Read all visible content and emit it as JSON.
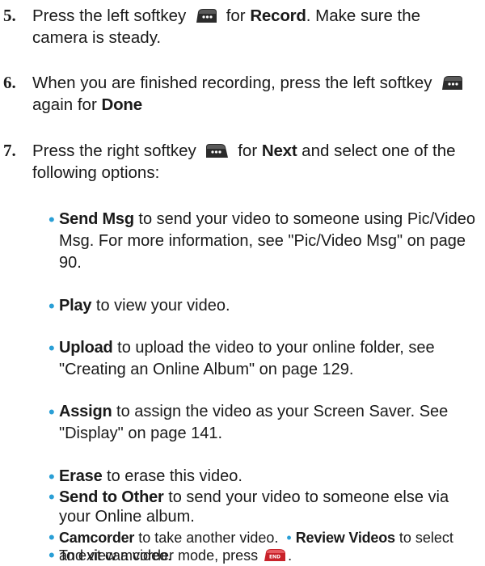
{
  "steps": [
    {
      "num": "5.",
      "part1": "Press the left softkey",
      "icon": "left-softkey-icon",
      "part2": " for ",
      "bold1": "Record",
      "part3": ". Make sure the camera is steady."
    },
    {
      "num": "6.",
      "part1": "When you are finished recording, press the left softkey",
      "icon": "left-softkey-icon",
      "part2": "again for ",
      "bold1": "Done"
    },
    {
      "num": "7.",
      "part1": "Press the right softkey",
      "icon": "right-softkey-icon",
      "part2": " for ",
      "bold1": "Next",
      "part3": " and select one of the following options:"
    }
  ],
  "options": [
    {
      "bold": "Send Msg",
      "text": " to send your video to someone using Pic/Video Msg. For more information, see \"Pic/Video Msg\" on page 90."
    },
    {
      "bold": "Play",
      "text": " to view your video."
    },
    {
      "bold": "Upload",
      "text": " to upload the video to your online folder, see \"Creating an Online Album\" on page 129."
    },
    {
      "bold": "Assign",
      "text": " to assign the video as your Screen Saver. See \"Display\" on page 141."
    },
    {
      "bold": "Erase",
      "text": " to erase this video."
    },
    {
      "bold": "Send to Other",
      "text": " to send your video to someone else via your Online album."
    },
    {
      "bold": "Camcorder",
      "text": " to take another video."
    },
    {
      "bold": "Review Videos",
      "text": " to select and view a video."
    }
  ],
  "exit_line": {
    "text": "To exit camcorder mode, press",
    "icon": "end-key-icon",
    "end": "."
  },
  "colors": {
    "bullet": "#2a9fd6",
    "softkey": "#2b2b2b",
    "end_key": "#c8222a"
  }
}
